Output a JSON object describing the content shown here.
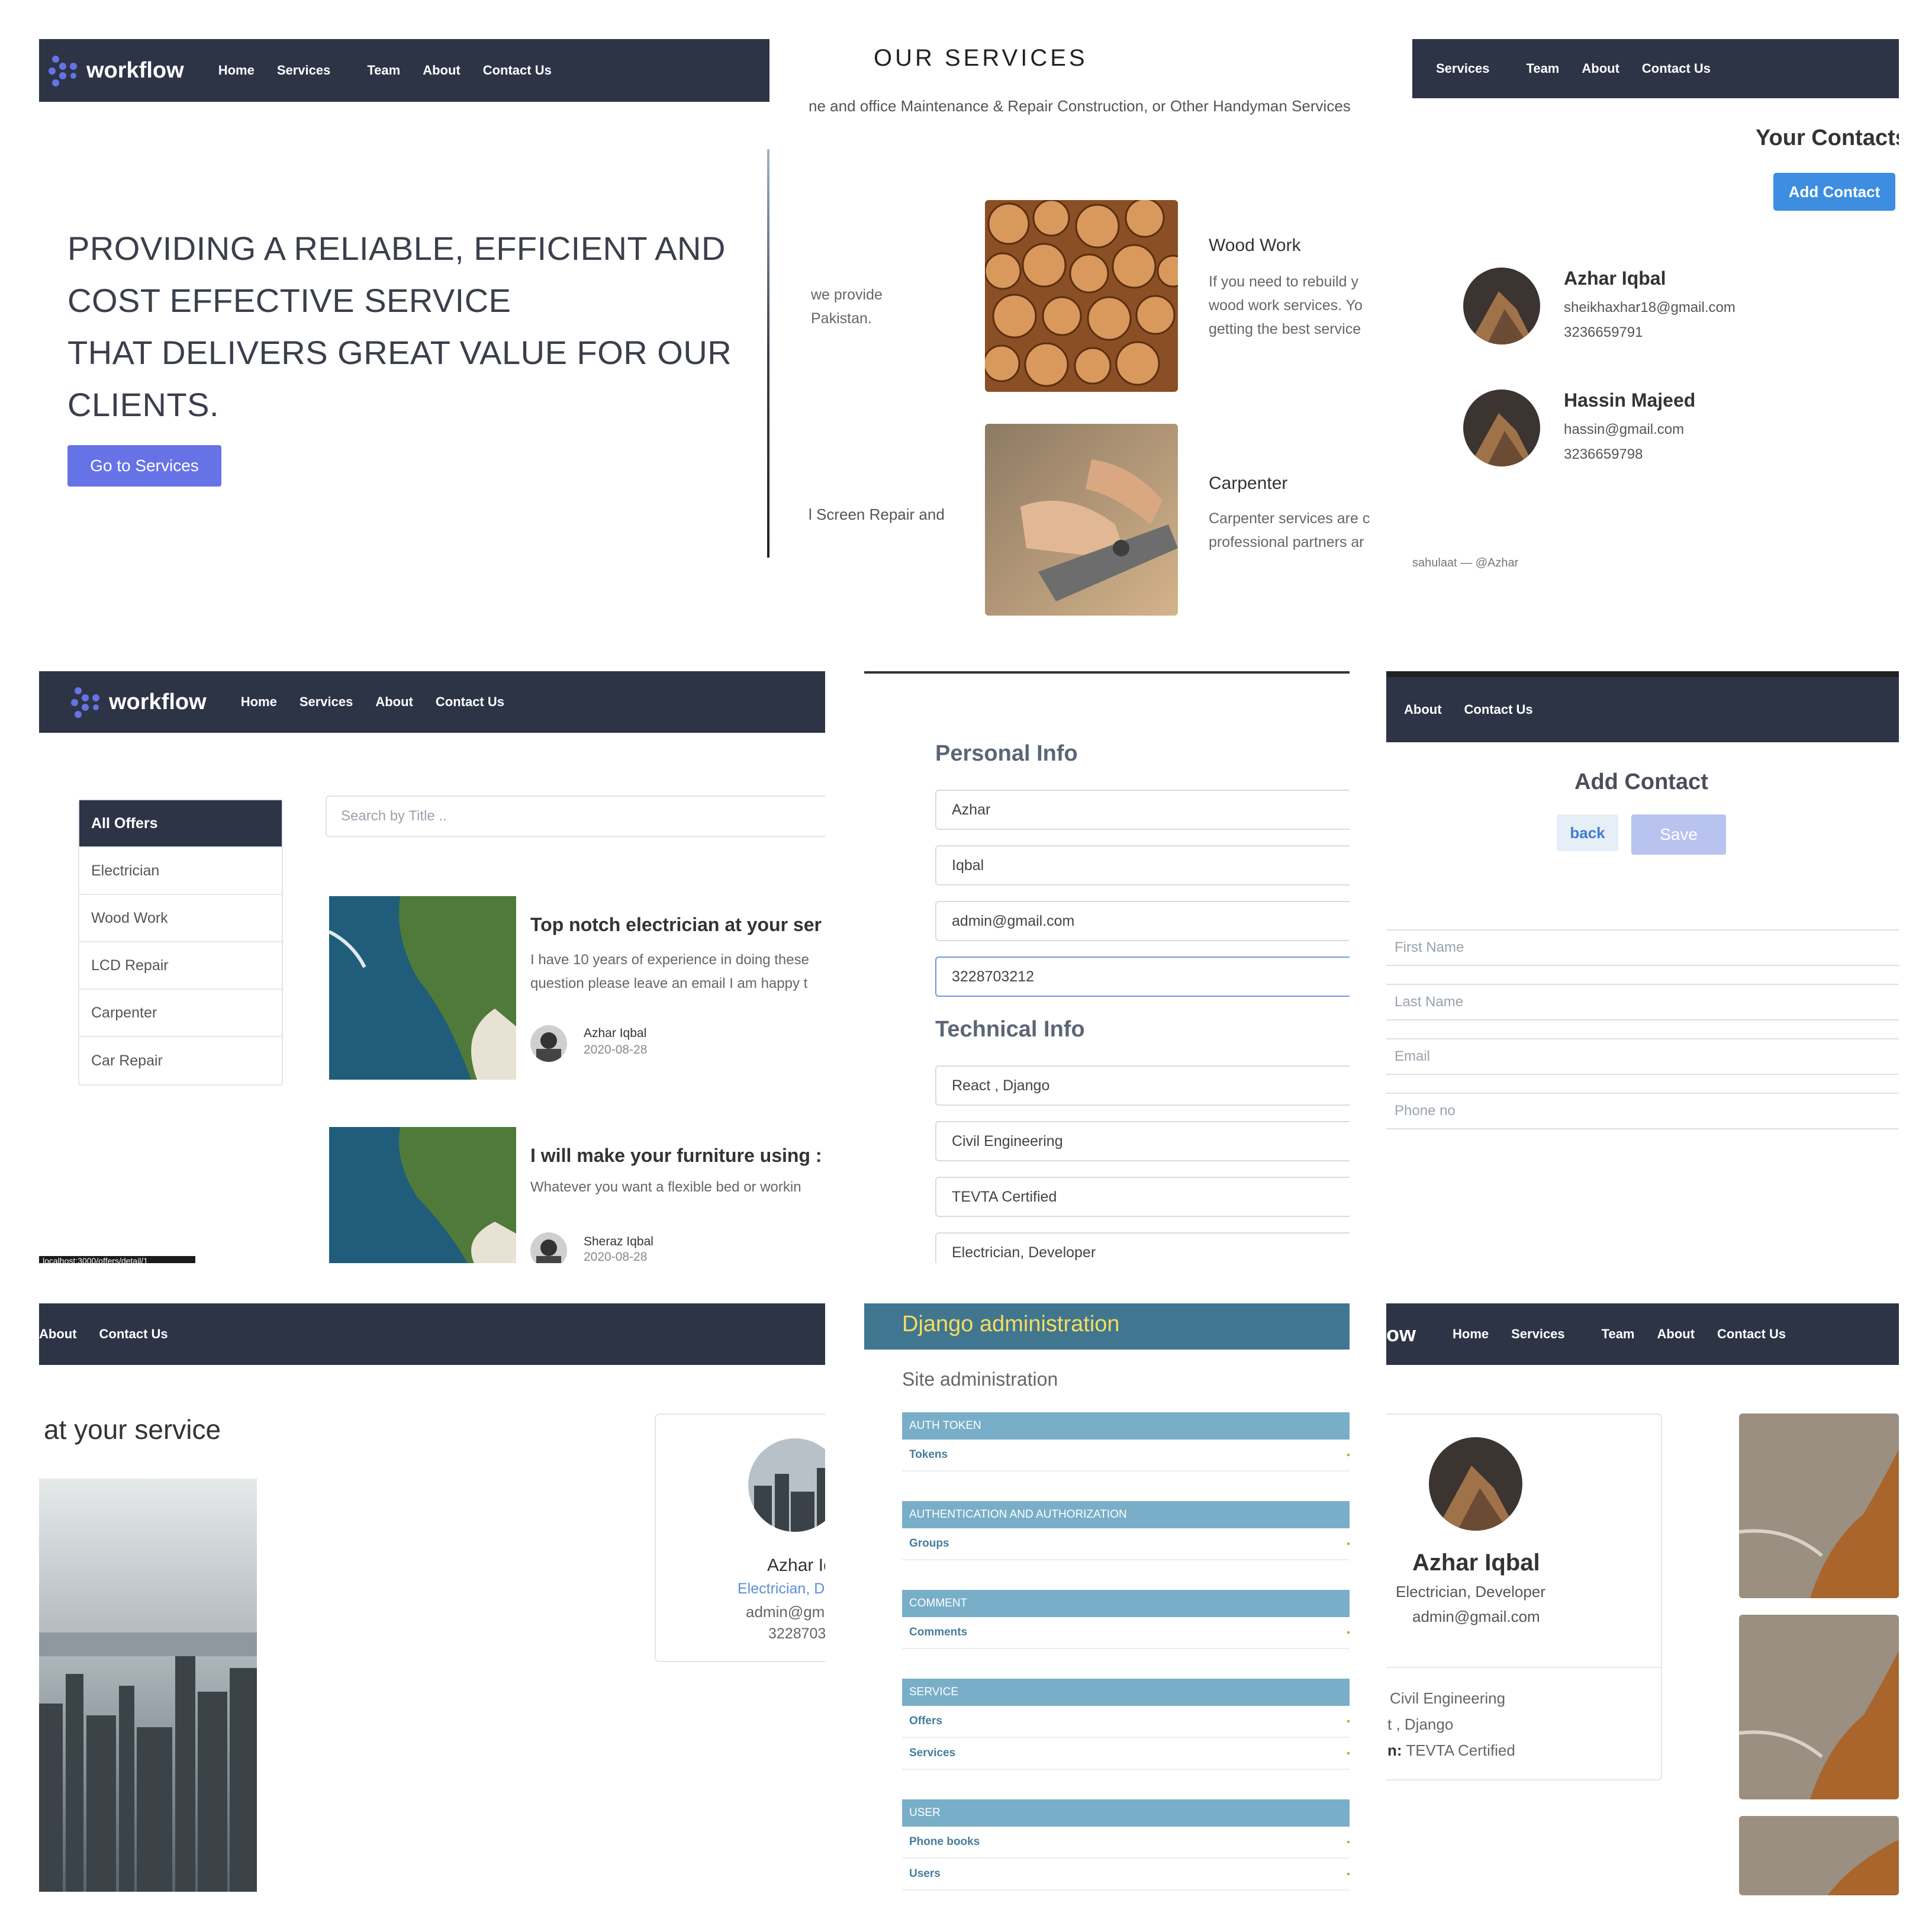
{
  "brand": {
    "name": "workflow"
  },
  "nav": {
    "home": "Home",
    "services": "Services",
    "team": "Team",
    "about": "About",
    "contact": "Contact Us"
  },
  "hero": {
    "line1": "PROVIDING A RELIABLE, EFFICIENT AND",
    "line2": "COST EFFECTIVE SERVICE",
    "line3": "THAT DELIVERS GREAT VALUE FOR OUR",
    "line4": "CLIENTS.",
    "button": "Go to Services"
  },
  "services_page": {
    "title": "OUR SERVICES",
    "subtitle": "ne and office Maintenance & Repair Construction, or Other Handyman Services",
    "left_text_1a": "we provide",
    "left_text_1b": "Pakistan.",
    "left_text_2": "l Screen Repair and",
    "items": [
      {
        "title": "Wood Work",
        "line1": "If you need to rebuild y",
        "line2": "wood work services. Yo",
        "line3": "getting the best service"
      },
      {
        "title": "Carpenter",
        "line1": "Carpenter services are c",
        "line2": "professional partners ar"
      }
    ]
  },
  "contacts_page": {
    "title": "Your Contacts",
    "add_button": "Add Contact",
    "contacts": [
      {
        "name": "Azhar Iqbal",
        "email": "sheikhaxhar18@gmail.com",
        "phone": "3236659791"
      },
      {
        "name": "Hassin Majeed",
        "email": "hassin@gmail.com",
        "phone": "3236659798"
      }
    ],
    "footer": "sahulaat — @Azhar"
  },
  "offers_page": {
    "search_placeholder": "Search by Title ..",
    "categories": [
      "All Offers",
      "Electrician",
      "Wood Work",
      "LCD Repair",
      "Carpenter",
      "Car Repair"
    ],
    "offers": [
      {
        "title": "Top notch electrician at your ser",
        "line1": "I have 10 years of experience in doing these",
        "line2": "question please leave an email I am happy t",
        "author": "Azhar Iqbal",
        "date": "2020-08-28"
      },
      {
        "title": "I will make your furniture using :",
        "line1": "Whatever you want a flexible bed or workin",
        "author": "Sheraz Iqbal",
        "date": "2020-08-28"
      }
    ],
    "status_url": "localhost:3000/offers/detail/1"
  },
  "profile_form": {
    "personal_heading": "Personal Info",
    "first_name": "Azhar",
    "last_name": "Iqbal",
    "email": "admin@gmail.com",
    "phone": "3228703212",
    "technical_heading": "Technical Info",
    "skills": "React , Django",
    "education": "Civil Engineering",
    "certification": "TEVTA Certified",
    "profession": "Electrician, Developer"
  },
  "add_contact": {
    "title": "Add Contact",
    "back": "back",
    "save": "Save",
    "placeholders": [
      "First Name",
      "Last Name",
      "Email",
      "Phone no"
    ]
  },
  "team_page": {
    "heading": "at your service",
    "card": {
      "name": "Azhar Ic",
      "role": "Electrician, D",
      "email": "admin@gm",
      "phone": "3228703"
    }
  },
  "django_admin": {
    "title": "Django administration",
    "subtitle": "Site administration",
    "sections": [
      {
        "name": "AUTH TOKEN",
        "rows": [
          "Tokens"
        ]
      },
      {
        "name": "AUTHENTICATION AND AUTHORIZATION",
        "rows": [
          "Groups"
        ]
      },
      {
        "name": "COMMENT",
        "rows": [
          "Comments"
        ]
      },
      {
        "name": "SERVICE",
        "rows": [
          "Offers",
          "Services"
        ]
      },
      {
        "name": "USER",
        "rows": [
          "Phone books",
          "Users"
        ]
      }
    ]
  },
  "profile_detail": {
    "brand_partial": "ow",
    "name": "Azhar Iqbal",
    "role": "Electrician, Developer",
    "email": "admin@gmail.com",
    "education": "Civil Engineering",
    "skills": "t , Django",
    "cert_label": "n:",
    "cert_value": "TEVTA Certified"
  },
  "colors": {
    "navbar": "#2d3446",
    "primary_button": "#6673e6",
    "add_contact_button": "#3d8de0",
    "django_header": "#417690",
    "django_section": "#79aec8",
    "django_link": "#447e9b"
  }
}
